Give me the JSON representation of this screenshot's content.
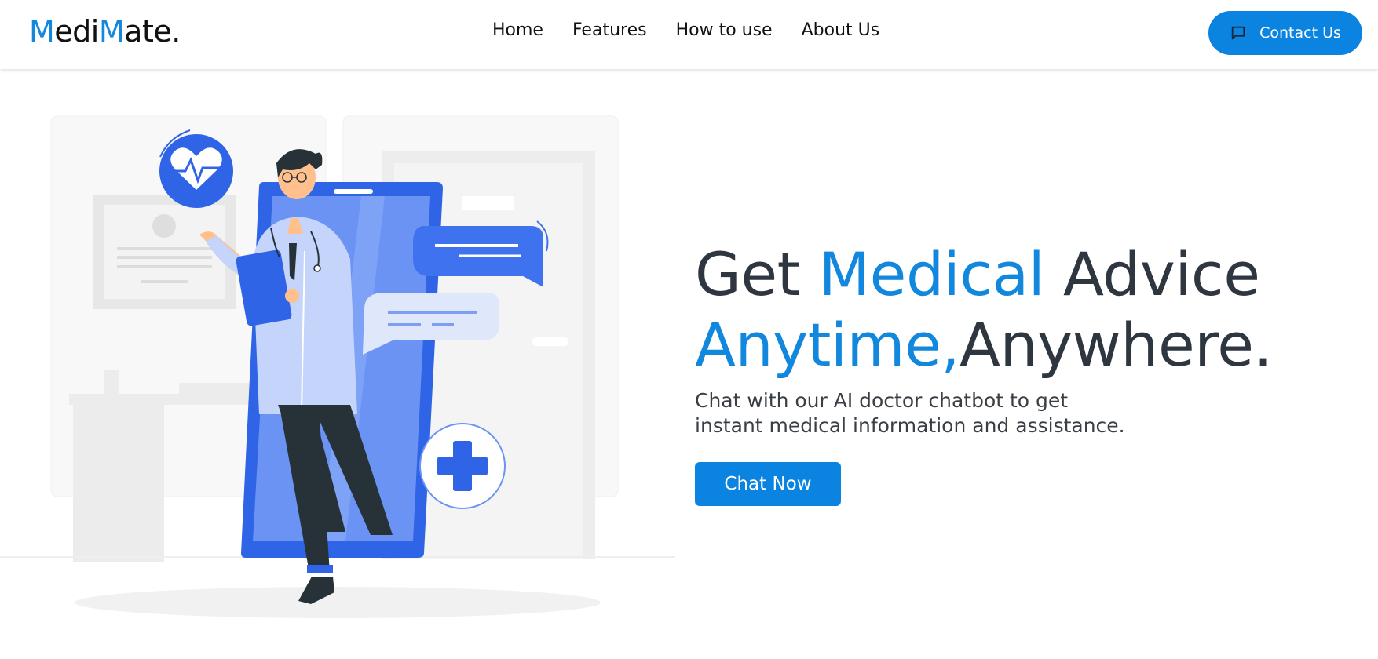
{
  "brand": {
    "logo_part1": "M",
    "logo_part2": "edi",
    "logo_part3": "M",
    "logo_part4": "ate.",
    "accent_color": "#1187dd"
  },
  "nav": {
    "items": [
      {
        "label": "Home"
      },
      {
        "label": "Features"
      },
      {
        "label": "How to use"
      },
      {
        "label": "About Us"
      }
    ]
  },
  "header": {
    "contact_label": "Contact Us",
    "contact_icon": "chat-bubble-icon",
    "button_color": "#0a84e0"
  },
  "hero": {
    "title_get": "Get ",
    "title_medical": "Medical",
    "title_advice": " Advice",
    "title_anytime": "Anytime,",
    "title_anywhere": "Anywhere.",
    "subtitle_line1": "Chat with our AI doctor chatbot to get",
    "subtitle_line2": "instant medical information and assistance.",
    "cta_label": "Chat Now",
    "illustration": "doctor-with-phone-illustration"
  }
}
